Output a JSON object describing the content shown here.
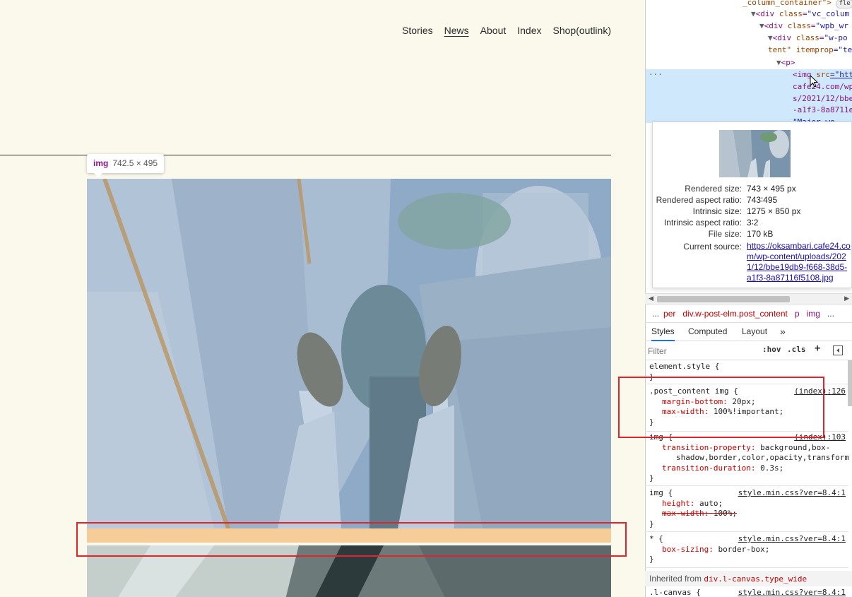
{
  "nav": {
    "items": [
      "Stories",
      "News",
      "About",
      "Index",
      "Shop(outlink)"
    ],
    "active": "News"
  },
  "tooltip": {
    "tag": "img",
    "dimensions": "742.5 × 495"
  },
  "dom": {
    "lines": [
      {
        "pre": "_column_container\">",
        "badge": "fle"
      },
      {
        "tag": "<div ",
        "attr": "class",
        "val": "\"vc_colum"
      },
      {
        "tag": "<div ",
        "attr": "class",
        "val": "\"wpb_wr"
      },
      {
        "tag": "<div ",
        "attr": "class",
        "val": "\"w-po"
      },
      {
        "tag": "",
        "attr": "tent\" itemprop",
        "val": "=\"te"
      },
      {
        "tag": "<p>",
        "attr": "",
        "val": ""
      },
      {
        "tag": "<img ",
        "attr": "src",
        "val": "=\"htt"
      }
    ],
    "link_lines": [
      "cafe24.com/wp",
      "s/2021/12/bbe",
      "-a1f3-8a8711e",
      "\"Major wo"
    ]
  },
  "preview": {
    "rows": [
      {
        "k": "Rendered size:",
        "v": "743 × 495 px"
      },
      {
        "k": "Rendered aspect ratio:",
        "v": "743∶495"
      },
      {
        "k": "Intrinsic size:",
        "v": "1275 × 850 px"
      },
      {
        "k": "Intrinsic aspect ratio:",
        "v": "3∶2"
      },
      {
        "k": "File size:",
        "v": "170 kB"
      }
    ],
    "current_source_label": "Current source:",
    "current_source": "https://oksambari.cafe24.com/wp-content/uploads/2021/12/bbe19db9-f668-38d5-a1f3-8a87116f5108.jpg"
  },
  "breadcrumbs": {
    "more": "...",
    "items": [
      "per",
      "div.w-post-elm.post_content",
      "p",
      "img"
    ],
    "overflow": "..."
  },
  "tabs": {
    "items": [
      "Styles",
      "Computed",
      "Layout"
    ],
    "more": "»",
    "active": "Styles"
  },
  "filter": {
    "placeholder": "Filter",
    "hov": ":hov",
    "cls": ".cls",
    "add": "+"
  },
  "rules": {
    "element_style": "element.style {",
    "close": "}",
    "post_content": {
      "selector": ".post_content img {",
      "origin": "(index):126",
      "props": [
        {
          "name": "margin-bottom",
          "value": "20px;"
        },
        {
          "name": "max-width",
          "value": "100%!important;"
        }
      ]
    },
    "img_index": {
      "selector": "img {",
      "origin": "(index):103",
      "props": [
        {
          "name": "transition-property",
          "value": "background,box-"
        },
        {
          "name": "",
          "value": "shadow,border,color,opacity,transform"
        },
        {
          "name": "transition-duration",
          "value": "0.3s;"
        }
      ]
    },
    "img_style": {
      "selector": "img {",
      "origin": "style.min.css?ver=8.4:1",
      "props": [
        {
          "name": "height",
          "value": "auto;"
        },
        {
          "name": "max-width",
          "value": "100%;"
        }
      ]
    },
    "universal": {
      "selector": "* {",
      "origin": "style.min.css?ver=8.4:1",
      "props": [
        {
          "name": "box-sizing",
          "value": "border-box;"
        }
      ]
    },
    "inherited_label": "Inherited from",
    "inherited_el": "div.l-canvas.type_wide",
    "lcanvas": {
      "selector": ".l-canvas {",
      "origin": "style.min.css?ver=8.4:1"
    }
  },
  "colors": {
    "highlight": "#e3232c",
    "margin_overlay": "#f6cc98",
    "selected_row": "#cfe8fc"
  }
}
